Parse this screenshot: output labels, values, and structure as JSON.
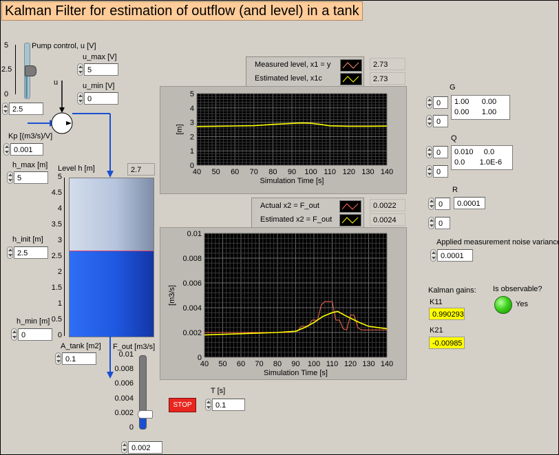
{
  "title": "Kalman Filter for estimation of outflow (and level) in a tank",
  "pump": {
    "label": "Pump control, u [V]",
    "scale": [
      "5",
      "2.5",
      "0"
    ],
    "value": "2.5",
    "slider_level": 0.5,
    "u_label": "u",
    "u_max_label": "u_max [V]",
    "u_max": "5",
    "u_min_label": "u_min [V]",
    "u_min": "0"
  },
  "kp": {
    "label": "Kp [(m3/s)/V]",
    "value": "0.001"
  },
  "h_max": {
    "label": "h_max [m]",
    "value": "5"
  },
  "h_init": {
    "label": "h_init [m]",
    "value": "2.5"
  },
  "h_min": {
    "label": "h_min [m]",
    "value": "0"
  },
  "a_tank": {
    "label": "A_tank [m2]",
    "value": "0.1"
  },
  "tank": {
    "label": "Level h [m]",
    "value": "2.7",
    "level": 2.7,
    "max": 5,
    "scale": [
      "5",
      "4.5",
      "4",
      "3.5",
      "3",
      "2.5",
      "2",
      "1.5",
      "1",
      "0.5",
      "0"
    ]
  },
  "fout": {
    "label": "F_out [m3/s]",
    "scale": [
      "0.01",
      "0.008",
      "0.006",
      "0.004",
      "0.002",
      "0"
    ],
    "value": "0.002",
    "level": 0.002,
    "max": 0.01
  },
  "legend1": {
    "rows": [
      {
        "label": "Measured level, x1 = y",
        "value": "2.73"
      },
      {
        "label": "Estimated level, x1c",
        "value": "2.73"
      }
    ]
  },
  "legend2": {
    "rows": [
      {
        "label": "Actual x2 = F_out",
        "value": "0.0022"
      },
      {
        "label": "Estimated x2 = F_out",
        "value": "0.0024"
      }
    ]
  },
  "matrices": {
    "g": {
      "label": "G",
      "idx1": "0",
      "idx2": "0",
      "row1": "1.00      0.00",
      "row2": "0.00      1.00"
    },
    "q": {
      "label": "Q",
      "idx1": "0",
      "idx2": "0",
      "row1": "0.010     0.0",
      "row2": "0.0       1.0E-6"
    },
    "r": {
      "label": "R",
      "idx1": "0",
      "idx2": "0",
      "value": "0.0001"
    }
  },
  "noise": {
    "label": "Applied measurement noise variance",
    "value": "0.0001"
  },
  "gains": {
    "label": "Kalman gains:",
    "k11_label": "K11",
    "k11": "0.990293",
    "k21_label": "K21",
    "k21": "-0.00985"
  },
  "observable": {
    "label": "Is observable?",
    "value": "Yes",
    "color": "#3fd21c"
  },
  "stop": {
    "label": "STOP",
    "color": "#e8261f"
  },
  "t": {
    "label": "T [s]",
    "value": "0.1"
  },
  "chart_data": [
    {
      "type": "line",
      "xlabel": "Simulation Time [s]",
      "ylabel": "[m]",
      "xlim": [
        40,
        140
      ],
      "ylim": [
        0,
        5
      ],
      "xticks": [
        "40",
        "50",
        "60",
        "70",
        "80",
        "90",
        "100",
        "110",
        "120",
        "130",
        "140"
      ],
      "yticks": [
        "5",
        "4",
        "3",
        "2",
        "1",
        "0"
      ],
      "grid": true,
      "series": [
        {
          "name": "Measured level, x1 = y",
          "color": "#ff8c69",
          "x": [
            40,
            50,
            60,
            70,
            80,
            90,
            95,
            100,
            105,
            110,
            120,
            130,
            140
          ],
          "y": [
            2.7,
            2.72,
            2.74,
            2.76,
            2.85,
            2.92,
            2.95,
            2.93,
            2.85,
            2.75,
            2.72,
            2.72,
            2.73
          ]
        },
        {
          "name": "Estimated level, x1c",
          "color": "#ffff00",
          "x": [
            40,
            50,
            60,
            70,
            80,
            90,
            95,
            100,
            105,
            110,
            120,
            130,
            140
          ],
          "y": [
            2.7,
            2.72,
            2.74,
            2.76,
            2.85,
            2.92,
            2.95,
            2.93,
            2.85,
            2.75,
            2.72,
            2.72,
            2.73
          ]
        }
      ]
    },
    {
      "type": "line",
      "xlabel": "Simulation Time [s]",
      "ylabel": "[m3/s]",
      "xlim": [
        40,
        140
      ],
      "ylim": [
        0,
        0.01
      ],
      "xticks": [
        "40",
        "50",
        "60",
        "70",
        "80",
        "90",
        "100",
        "110",
        "120",
        "130",
        "140"
      ],
      "yticks": [
        "0.01",
        "0.008",
        "0.006",
        "0.004",
        "0.002",
        "0"
      ],
      "grid": true,
      "series": [
        {
          "name": "Actual x2 = F_out",
          "color": "#ff6a4a",
          "x": [
            40,
            85,
            91,
            93,
            97,
            99,
            102,
            104,
            106,
            108,
            110,
            112,
            114,
            116,
            118,
            120,
            122,
            124,
            126,
            128,
            130,
            135,
            140
          ],
          "y": [
            0.002,
            0.002,
            0.0021,
            0.0025,
            0.0025,
            0.003,
            0.003,
            0.0042,
            0.0045,
            0.0045,
            0.0045,
            0.003,
            0.003,
            0.0023,
            0.0022,
            0.0034,
            0.0034,
            0.0024,
            0.0022,
            0.0022,
            0.0022,
            0.0022,
            0.0022
          ]
        },
        {
          "name": "Estimated x2 = F_out",
          "color": "#ffff00",
          "x": [
            40,
            60,
            80,
            90,
            95,
            100,
            105,
            110,
            113,
            118,
            125,
            130,
            135,
            140
          ],
          "y": [
            0.0018,
            0.0019,
            0.002,
            0.0021,
            0.0024,
            0.0028,
            0.0033,
            0.0036,
            0.0037,
            0.0033,
            0.0028,
            0.0025,
            0.0024,
            0.0023
          ]
        }
      ]
    }
  ]
}
